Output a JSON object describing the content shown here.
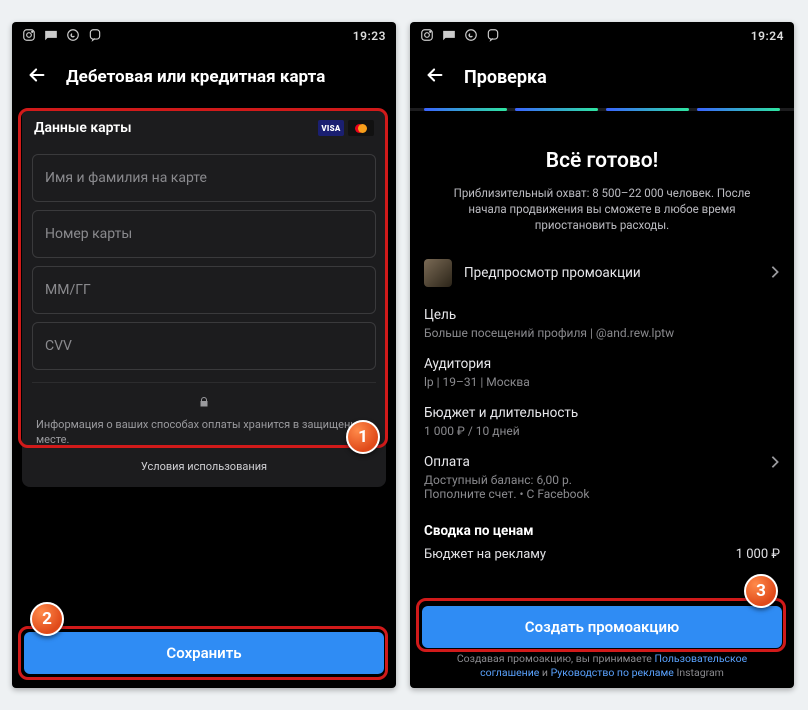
{
  "left": {
    "status": {
      "time": "19:23"
    },
    "header": {
      "title": "Дебетовая или кредитная карта"
    },
    "card": {
      "section_title": "Данные карты",
      "fields": {
        "name": "Имя и фамилия на карте",
        "number": "Номер карты",
        "expiry": "MM/ГГ",
        "cvv": "CVV"
      },
      "secure_text": "Информация о ваших способах оплаты хранится в защищенном месте.",
      "terms": "Условия использования"
    },
    "save_label": "Сохранить",
    "badges": {
      "one": "1",
      "two": "2"
    }
  },
  "right": {
    "status": {
      "time": "19:24"
    },
    "header": {
      "title": "Проверка"
    },
    "ready": {
      "heading": "Всё готово!",
      "sub": "Приблизительный охват: 8 500–22 000 человек. После начала продвижения вы сможете в любое время приостановить расходы."
    },
    "preview_label": "Предпросмотр промоакции",
    "goal": {
      "k": "Цель",
      "v": "Больше посещений профиля | @and.rew.lptw"
    },
    "audience": {
      "k": "Аудитория",
      "v": "lp | 19–31 | Москва"
    },
    "budget": {
      "k": "Бюджет и длительность",
      "v": "1 000 ₽ / 10 дней"
    },
    "payment": {
      "k": "Оплата",
      "v1": "Доступный баланс: 6,00 р.",
      "v2": "Пополните счет. • С Facebook"
    },
    "summary": {
      "title": "Сводка по ценам",
      "line_k": "Бюджет на рекламу",
      "line_v": "1 000 ₽"
    },
    "create_label": "Создать промоакцию",
    "foot": {
      "pre": "Создавая промоакцию, вы принимаете ",
      "link1": "Пользовательское соглашение",
      "mid": " и ",
      "link2": "Руководство по рекламе",
      "post": " Instagram"
    },
    "badges": {
      "three": "3"
    }
  }
}
